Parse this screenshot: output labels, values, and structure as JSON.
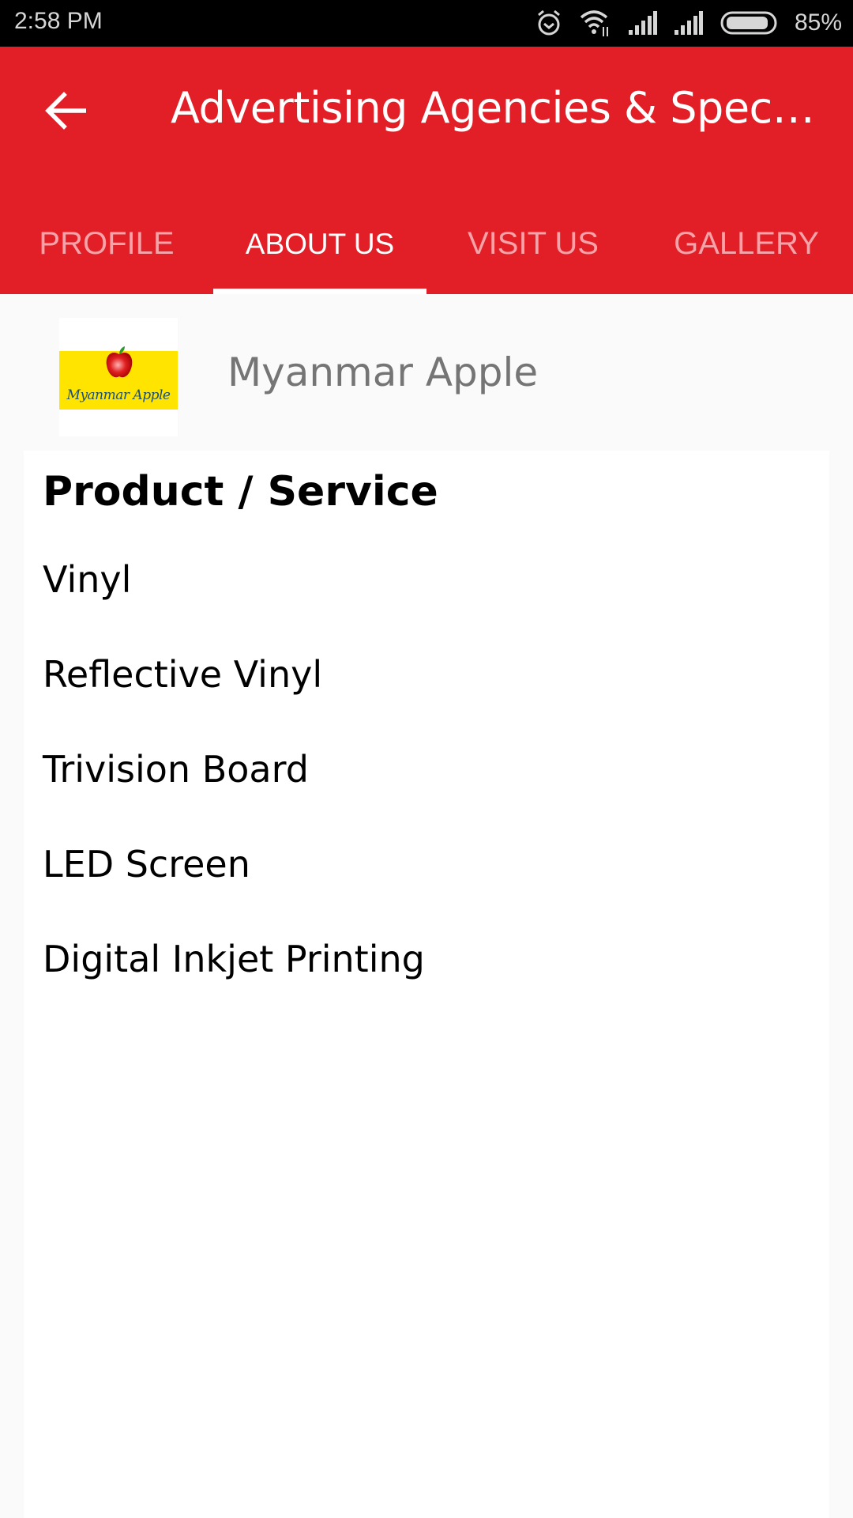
{
  "status_bar": {
    "time": "2:58 PM",
    "icons": [
      "alarm-icon",
      "wifi-icon",
      "signal-icon",
      "signal-icon",
      "battery-icon"
    ],
    "battery_percent": "85%",
    "battery_level": 0.85
  },
  "app_bar": {
    "back_icon": "arrow-left-icon",
    "title": "Advertising Agencies & Speci...",
    "color": "#e21e26"
  },
  "tabs": [
    {
      "label": "PROFILE",
      "active": false
    },
    {
      "label": "ABOUT US",
      "active": true
    },
    {
      "label": "VISIT US",
      "active": false
    },
    {
      "label": "GALLERY",
      "active": false
    }
  ],
  "company": {
    "logo_text": "Myanmar Apple",
    "name": "Myanmar Apple"
  },
  "card": {
    "heading": "Product / Service",
    "items": [
      "Vinyl",
      "Reflective Vinyl",
      "Trivision Board",
      "LED Screen",
      "Digital Inkjet Printing"
    ]
  }
}
